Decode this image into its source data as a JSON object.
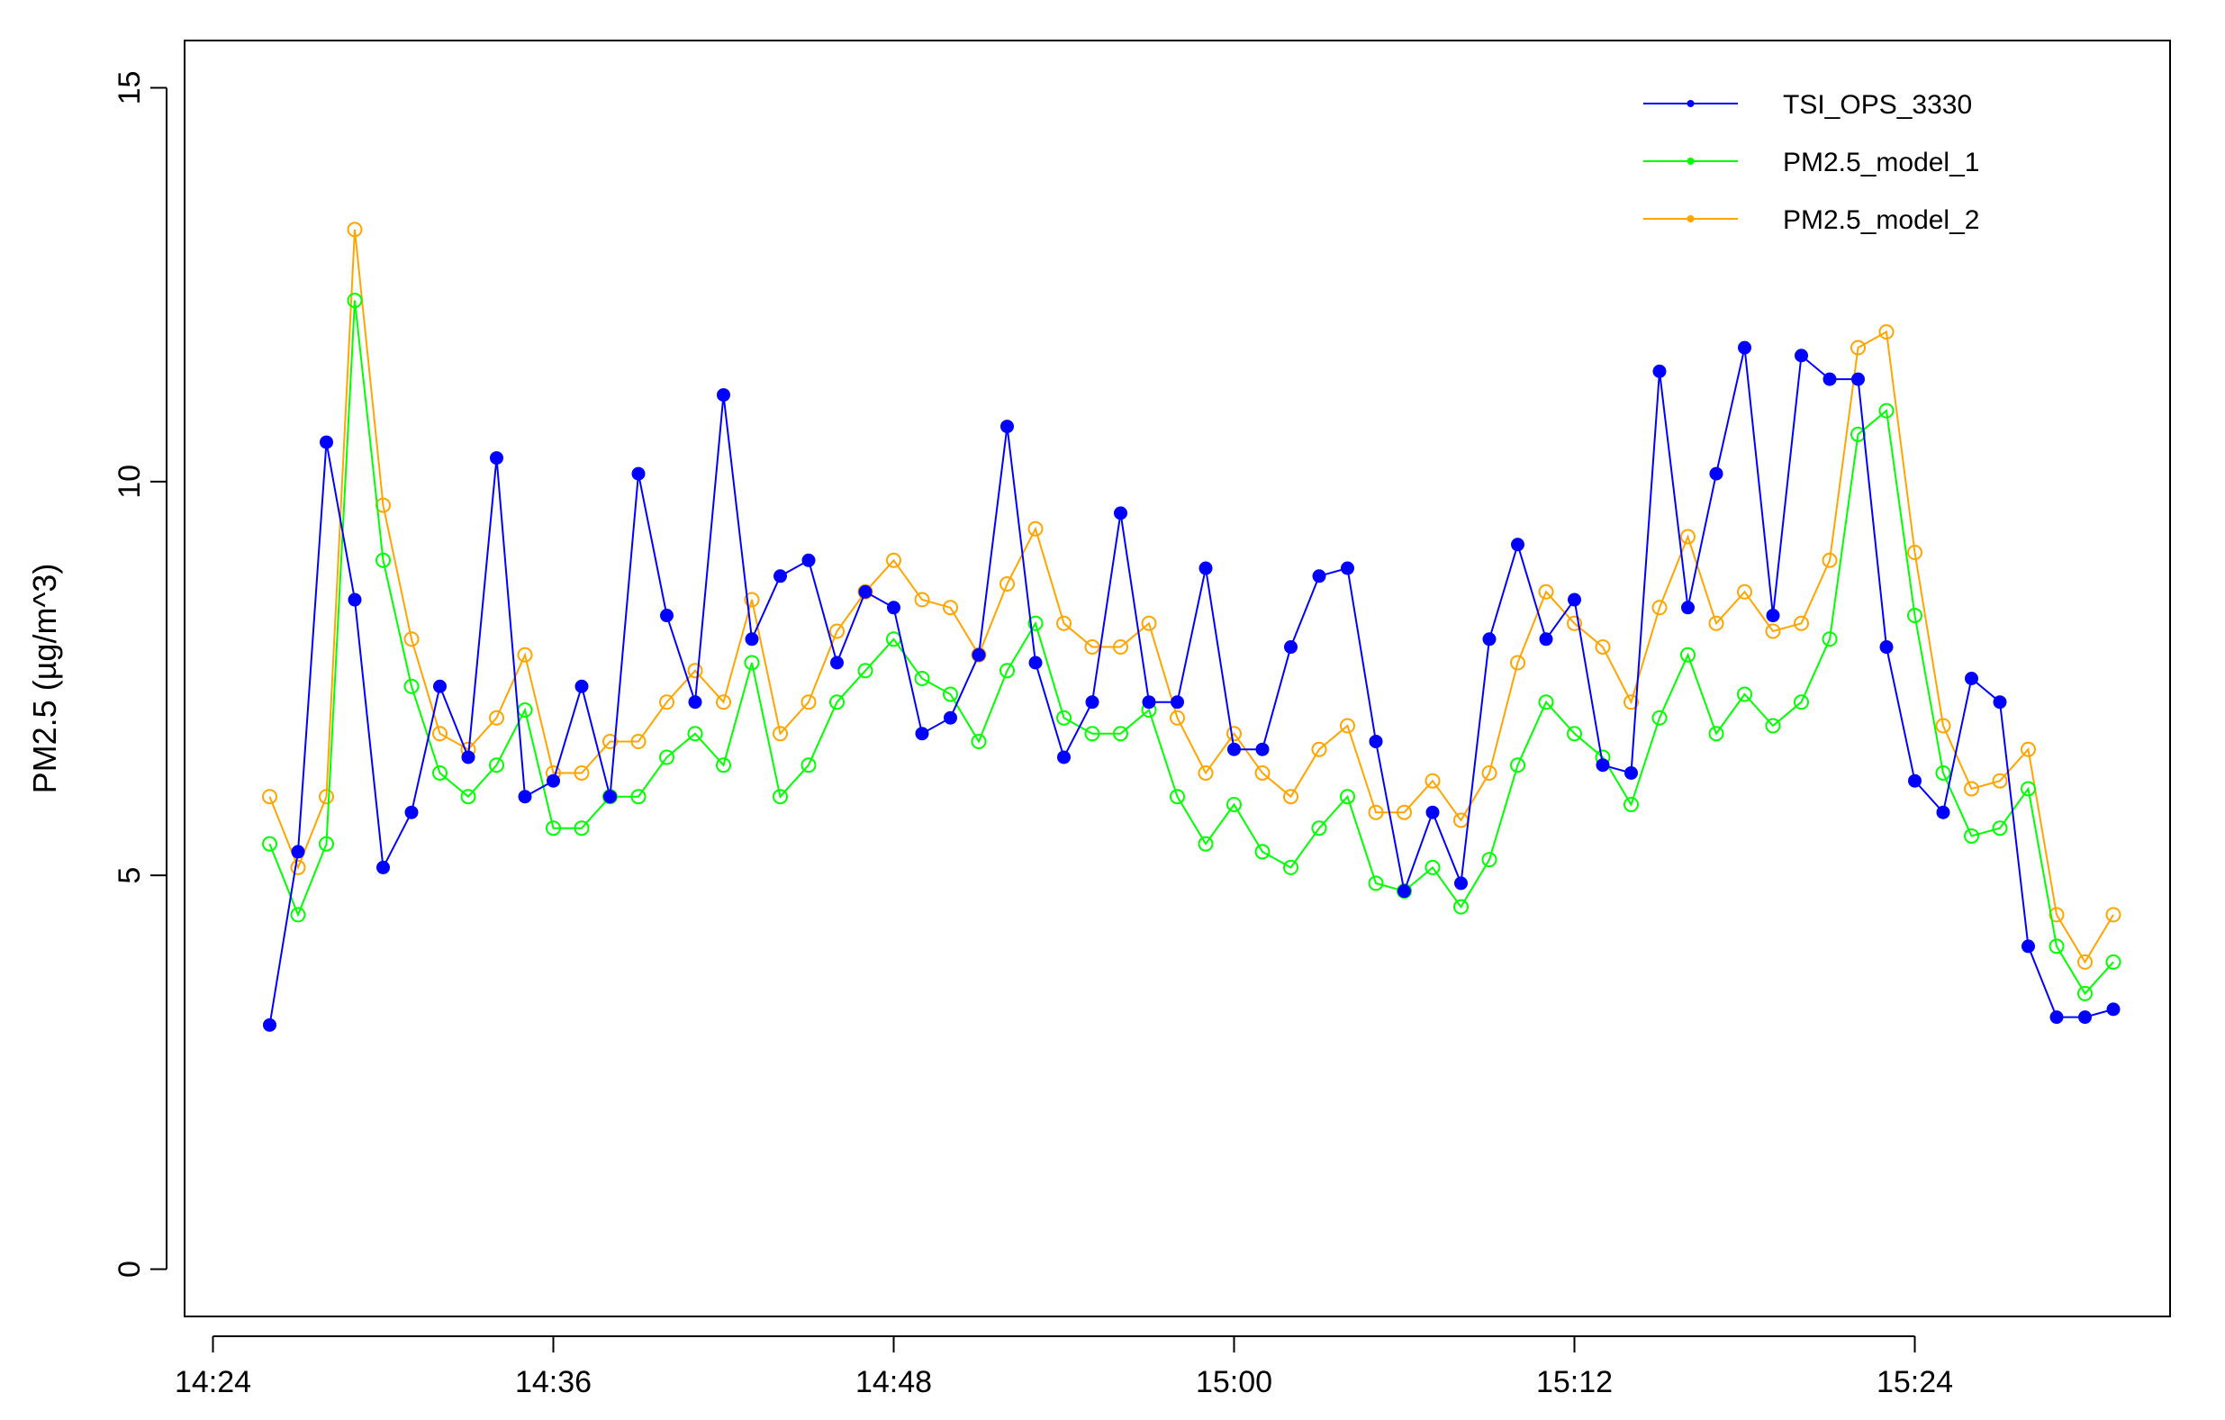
{
  "chart_data": {
    "type": "line",
    "ylabel": "PM2.5 (µg/m^3)",
    "xlabel": "",
    "ylim": [
      -0.6,
      15.6
    ],
    "xlim": [
      -1,
      69
    ],
    "yticks": [
      0,
      5,
      10,
      15
    ],
    "xticks": [
      {
        "pos": 0,
        "label": "14:24"
      },
      {
        "pos": 12,
        "label": "14:36"
      },
      {
        "pos": 24,
        "label": "14:48"
      },
      {
        "pos": 36,
        "label": "15:00"
      },
      {
        "pos": 48,
        "label": "15:12"
      },
      {
        "pos": 60,
        "label": "15:24"
      }
    ],
    "grid": false,
    "legend_position": "top-right",
    "x_start": 2,
    "series": [
      {
        "name": "TSI_OPS_3330",
        "color": "#0000ff",
        "marker": "filled",
        "values": [
          3.1,
          5.3,
          10.5,
          8.5,
          5.1,
          5.8,
          7.4,
          6.5,
          10.3,
          6.0,
          6.2,
          7.4,
          6.0,
          10.1,
          8.3,
          7.2,
          11.1,
          8.0,
          8.8,
          9.0,
          7.7,
          8.6,
          8.4,
          6.8,
          7.0,
          7.8,
          10.7,
          7.7,
          6.5,
          7.2,
          9.6,
          7.2,
          7.2,
          8.9,
          6.6,
          6.6,
          7.9,
          8.8,
          8.9,
          6.7,
          4.8,
          5.8,
          4.9,
          8.0,
          9.2,
          8.0,
          8.5,
          6.4,
          6.3,
          11.4,
          8.4,
          10.1,
          11.7,
          8.3,
          11.6,
          11.3,
          11.3,
          7.9,
          6.2,
          5.8,
          7.5,
          7.2,
          4.1,
          3.2,
          3.2,
          3.3
        ]
      },
      {
        "name": "PM2.5_model_1",
        "color": "#00ff00",
        "marker": "open",
        "values": [
          5.4,
          4.5,
          5.4,
          12.3,
          9.0,
          7.4,
          6.3,
          6.0,
          6.4,
          7.1,
          5.6,
          5.6,
          6.0,
          6.0,
          6.5,
          6.8,
          6.4,
          7.7,
          6.0,
          6.4,
          7.2,
          7.6,
          8.0,
          7.5,
          7.3,
          6.7,
          7.6,
          8.2,
          7.0,
          6.8,
          6.8,
          7.1,
          6.0,
          5.4,
          5.9,
          5.3,
          5.1,
          5.6,
          6.0,
          4.9,
          4.8,
          5.1,
          4.6,
          5.2,
          6.4,
          7.2,
          6.8,
          6.5,
          5.9,
          7.0,
          7.8,
          6.8,
          7.3,
          6.9,
          7.2,
          8.0,
          10.6,
          10.9,
          8.3,
          6.3,
          5.5,
          5.6,
          6.1,
          4.1,
          3.5,
          3.9
        ]
      },
      {
        "name": "PM2.5_model_2",
        "color": "#ffa500",
        "marker": "open",
        "values": [
          6.0,
          5.1,
          6.0,
          13.2,
          9.7,
          8.0,
          6.8,
          6.6,
          7.0,
          7.8,
          6.3,
          6.3,
          6.7,
          6.7,
          7.2,
          7.6,
          7.2,
          8.5,
          6.8,
          7.2,
          8.1,
          8.6,
          9.0,
          8.5,
          8.4,
          7.8,
          8.7,
          9.4,
          8.2,
          7.9,
          7.9,
          8.2,
          7.0,
          6.3,
          6.8,
          6.3,
          6.0,
          6.6,
          6.9,
          5.8,
          5.8,
          6.2,
          5.7,
          6.3,
          7.7,
          8.6,
          8.2,
          7.9,
          7.2,
          8.4,
          9.3,
          8.2,
          8.6,
          8.1,
          8.2,
          9.0,
          11.7,
          11.9,
          9.1,
          6.9,
          6.1,
          6.2,
          6.6,
          4.5,
          3.9,
          4.5
        ]
      }
    ]
  }
}
